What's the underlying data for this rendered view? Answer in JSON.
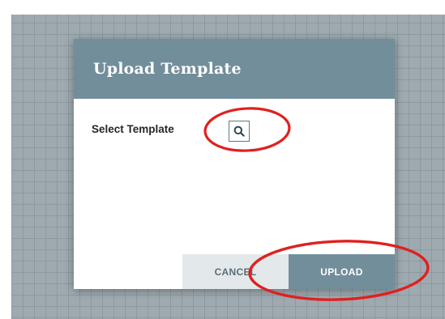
{
  "dialog": {
    "title": "Upload Template",
    "field_label": "Select Template",
    "search_icon": "search-icon",
    "cancel_label": "CANCEL",
    "upload_label": "UPLOAD"
  },
  "colors": {
    "header": "#728e9b",
    "cancel_bg": "#e3e8eb",
    "annotation": "#e02020"
  }
}
